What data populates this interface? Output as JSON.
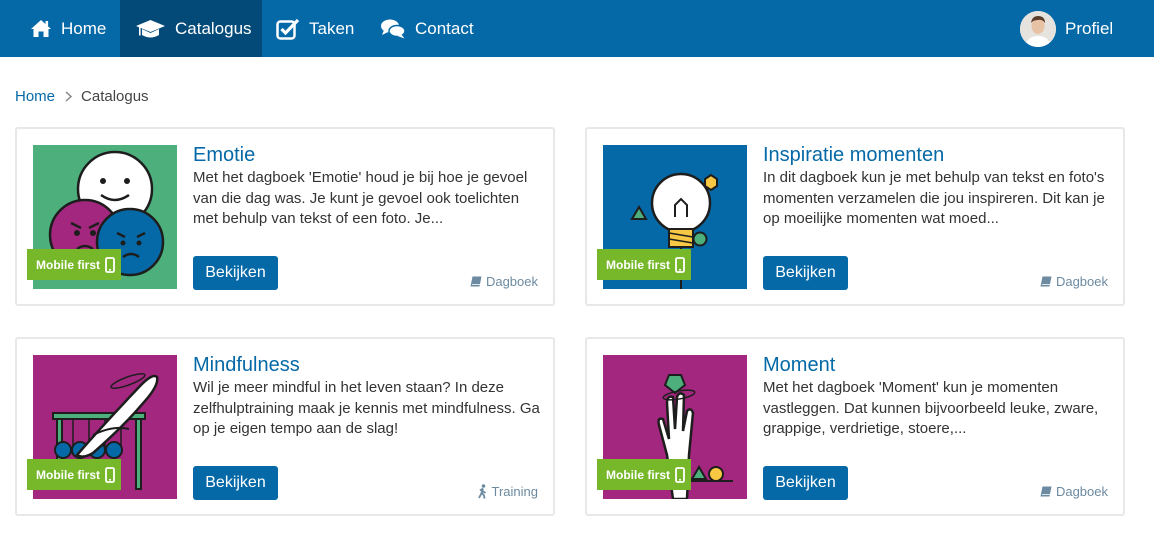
{
  "nav": {
    "home": "Home",
    "catalogus": "Catalogus",
    "taken": "Taken",
    "contact": "Contact",
    "profiel": "Profiel"
  },
  "breadcrumb": {
    "home": "Home",
    "current": "Catalogus"
  },
  "colors": {
    "primary": "#0569a7",
    "nav_active": "#034a78",
    "badge": "#76b82a"
  },
  "cards": [
    {
      "title": "Emotie",
      "description": "Met het dagboek 'Emotie' houd je bij hoe je gevoel van die dag was. Je kunt je gevoel ook toelichten met behulp van tekst of een foto. Je...",
      "badge": "Mobile first",
      "button": "Bekijken",
      "type": "Dagboek",
      "type_icon": "book-icon",
      "image_bg": "#4caf7c"
    },
    {
      "title": "Inspiratie momenten",
      "description": "In dit dagboek kun je met behulp van tekst en foto's momenten verzamelen die jou inspireren. Dit kan je op moeilijke momenten wat moed...",
      "badge": "Mobile first",
      "button": "Bekijken",
      "type": "Dagboek",
      "type_icon": "book-icon",
      "image_bg": "#0569a7"
    },
    {
      "title": "Mindfulness",
      "description": "Wil je meer mindful in het leven staan? In deze zelfhulptraining maak je kennis met mindfulness. Ga op je eigen tempo aan de slag!",
      "badge": "Mobile first",
      "button": "Bekijken",
      "type": "Training",
      "type_icon": "walking-person-icon",
      "image_bg": "#a3277f"
    },
    {
      "title": "Moment",
      "description": "Met het dagboek 'Moment' kun je momenten vastleggen. Dat kunnen bijvoorbeeld leuke, zware, grappige, verdrietige, stoere,...",
      "badge": "Mobile first",
      "button": "Bekijken",
      "type": "Dagboek",
      "type_icon": "book-icon",
      "image_bg": "#a3277f"
    }
  ]
}
